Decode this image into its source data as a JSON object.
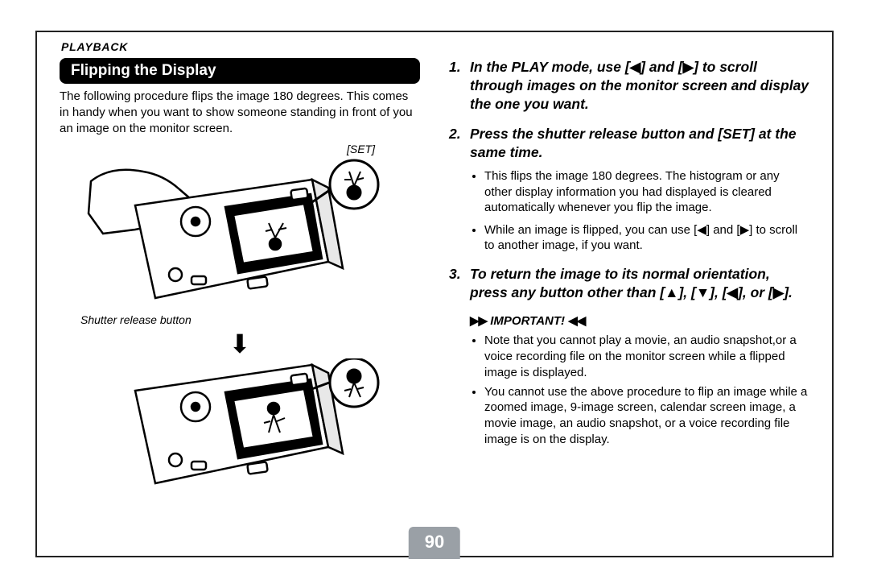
{
  "header": {
    "section_label": "PLAYBACK",
    "page_number": "90"
  },
  "left": {
    "section_title": "Flipping the Display",
    "intro_text": "The following procedure flips the image 180 degrees. This comes in handy when you want to show someone standing in front of you an image on the monitor screen.",
    "label_set": "[SET]",
    "label_shutter": "Shutter release button"
  },
  "right": {
    "step1_a": "In the PLAY mode, use [",
    "step1_b": "] and [",
    "step1_c": "] to scroll through images on the monitor screen and display the one you want.",
    "step2": "Press the shutter release button and [SET] at the same time.",
    "step2_bullet1_a": "This flips the image 180 degrees. The histogram or any other display information you had displayed is cleared automatically whenever you flip the image.",
    "step2_bullet2_a": "While an image is flipped, you can use [",
    "step2_bullet2_b": "] and [",
    "step2_bullet2_c": "] to scroll to another image, if you want.",
    "step3_a": "To return the image to its normal orientation, press any button other than [",
    "step3_b": "], [",
    "step3_c": "], [",
    "step3_d": "], or [",
    "step3_e": "].",
    "important_label": "IMPORTANT!",
    "important_1": "Note that you cannot play a movie, an audio snapshot,or a voice recording file on the monitor screen while a flipped image is displayed.",
    "important_2": "You cannot use the above procedure to flip an image while a zoomed image, 9-image screen, calendar screen image, a movie image, an audio snapshot, or a voice recording file image is on the display."
  },
  "glyphs": {
    "left": "◀",
    "right": "▶",
    "up": "▲",
    "down": "▼"
  }
}
